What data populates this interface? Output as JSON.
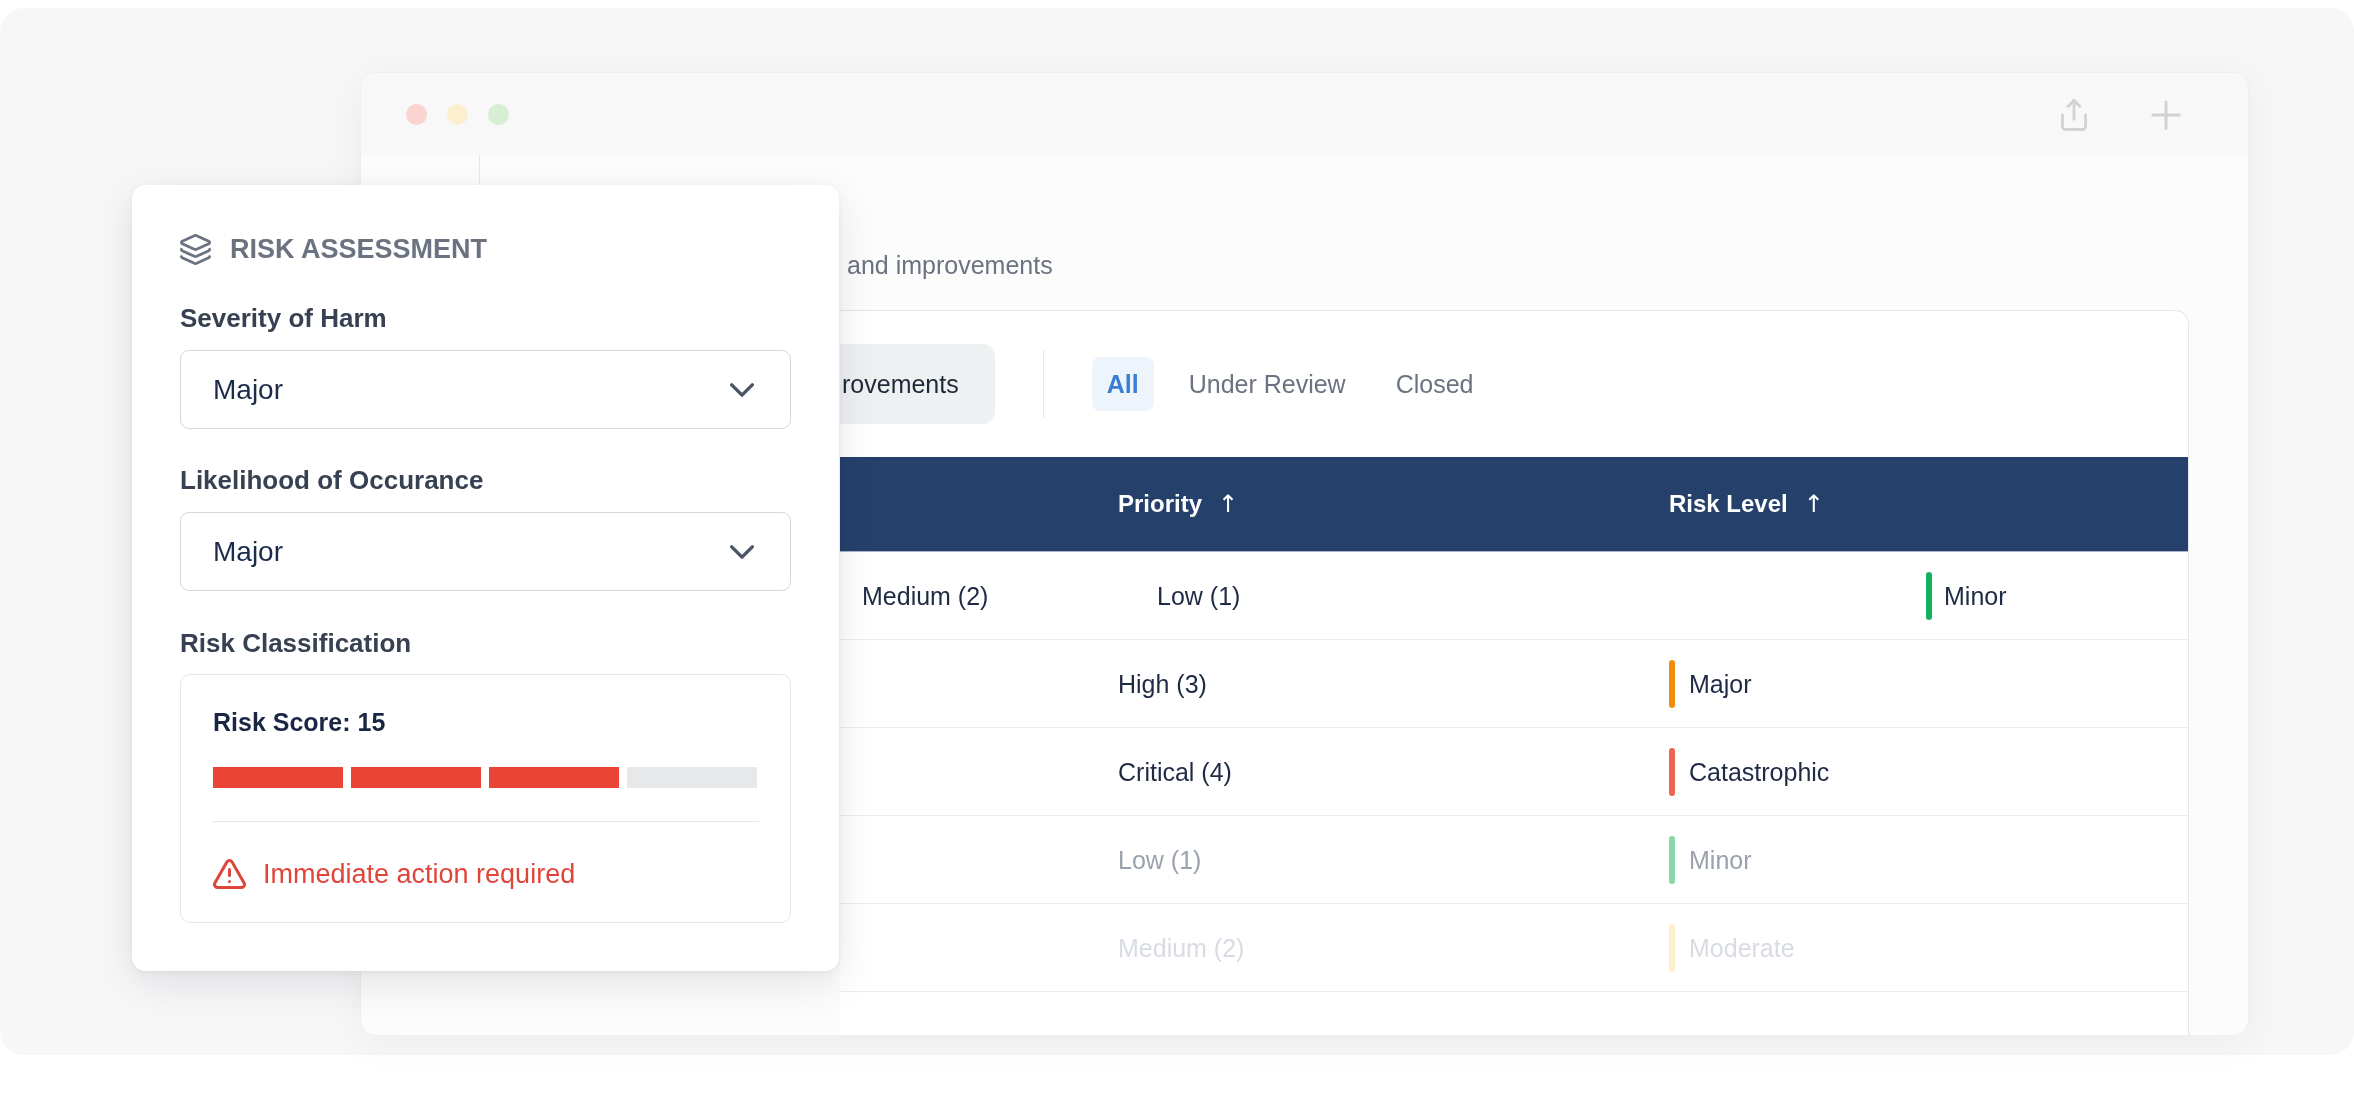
{
  "page": {
    "subtitle": "and improvements"
  },
  "view_tabs": [
    {
      "label": "rovements",
      "selected": true
    }
  ],
  "filters": [
    {
      "label": "All",
      "selected": true
    },
    {
      "label": "Under Review",
      "selected": false
    },
    {
      "label": "Closed",
      "selected": false
    }
  ],
  "table": {
    "columns": [
      {
        "label": "Priority",
        "sort_arrow": "↑"
      },
      {
        "label": "Risk Level",
        "sort_arrow": "↑"
      }
    ],
    "rows": [
      {
        "kind": "shifted",
        "column_1": "Medium (2)",
        "priority": "Low (1)",
        "risk_level": "Minor",
        "color": "#12b35b"
      },
      {
        "kind": "plain",
        "priority": "High (3)",
        "risk_level": "Major",
        "color": "#f28c0c"
      },
      {
        "kind": "plain",
        "priority": "Critical (4)",
        "risk_level": "Catastrophic",
        "color": "#ee6352"
      },
      {
        "kind": "dim",
        "priority": "Low (1)",
        "risk_level": "Minor",
        "color": "#85d7a8"
      },
      {
        "kind": "faint",
        "priority": "Medium (2)",
        "risk_level": "Moderate",
        "color": "#fcf0cc"
      }
    ]
  },
  "risk_panel": {
    "title": "RISK ASSESSMENT",
    "fields": [
      {
        "label": "Severity of Harm",
        "value": "Major"
      },
      {
        "label": "Likelihood of Occurance",
        "value": "Major"
      }
    ],
    "classification": {
      "label": "Risk Classification",
      "score": "Risk Score: 15",
      "level": 0.75,
      "alert": "Immediate action required"
    }
  }
}
